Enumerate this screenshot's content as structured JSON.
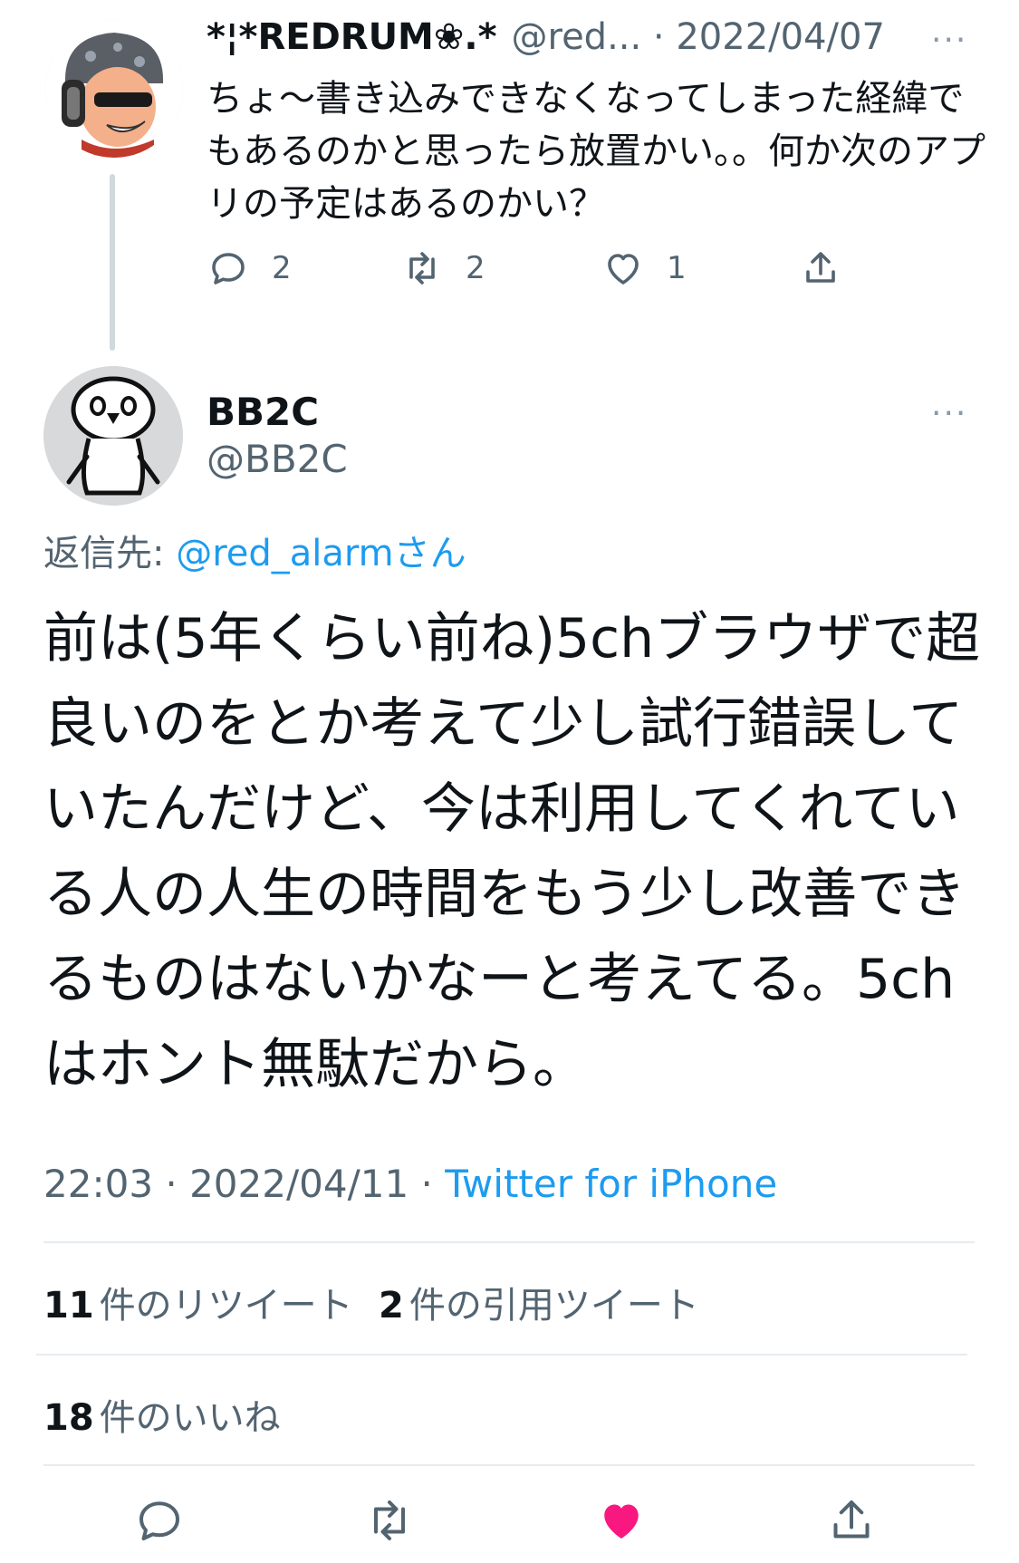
{
  "reply_tweet": {
    "display_name": "*¦*REDRUM❀.*",
    "meta": "@red... · 2022/04/07",
    "more": "···",
    "text": "ちょ〜書き込みできなくなってしまった経緯でもあるのかと思ったら放置かい。。何か次のアプリの予定はあるのかい？",
    "reply_count": "2",
    "retweet_count": "2",
    "like_count": "1"
  },
  "main_tweet": {
    "display_name": "BB2C",
    "handle": "@BB2C",
    "more": "···",
    "replying_prefix": "返信先: ",
    "replying_to": "@red_alarm",
    "replying_suffix": "さん",
    "text": "前は(5年くらい前ね)5chブラウザで超良いのをとか考えて少し試行錯誤していたんだけど、今は利用してくれている人の人生の時間をもう少し改善できるものはないかなーと考えてる。5chはホント無駄だから。",
    "time_date": "22:03 · 2022/04/11 · ",
    "source": "Twitter for iPhone"
  },
  "stats": {
    "retweets_count": "11",
    "retweets_label": "件のリツイート",
    "quotes_count": "2",
    "quotes_label": "件の引用ツイート",
    "likes_count": "18",
    "likes_label": "件のいいね"
  },
  "colors": {
    "link": "#1d9bf0",
    "like_active": "#f91880",
    "muted": "#536471"
  },
  "icons": [
    "reply-icon",
    "retweet-icon",
    "like-icon",
    "share-icon"
  ]
}
